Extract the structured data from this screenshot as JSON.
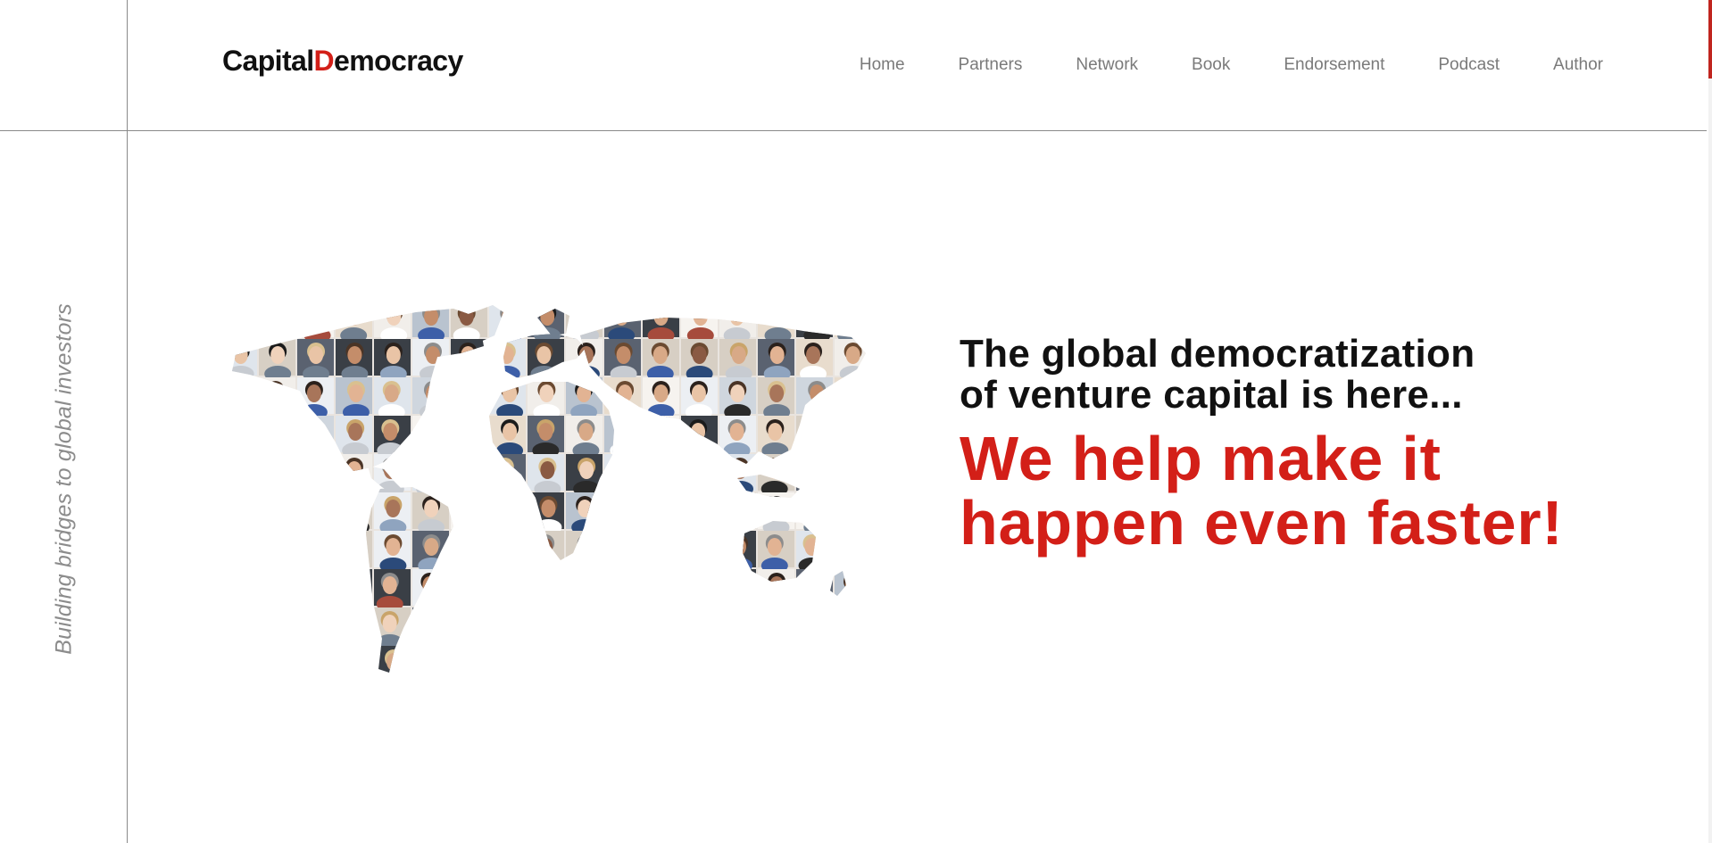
{
  "brand": {
    "logo_part1": "Capital",
    "logo_accent": "D",
    "logo_part2": "emocracy",
    "accent_color": "#d31f18"
  },
  "nav": {
    "items": [
      {
        "label": "Home"
      },
      {
        "label": "Partners"
      },
      {
        "label": "Network"
      },
      {
        "label": "Book"
      },
      {
        "label": "Endorsement"
      },
      {
        "label": "Podcast"
      },
      {
        "label": "Author"
      }
    ]
  },
  "side": {
    "tagline": "Building bridges to global investors"
  },
  "hero": {
    "map_icon": "world-map-photo-collage",
    "subheading_line1": "The global democratization",
    "subheading_line2": "of venture capital is here...",
    "headline_line1": "We help make it",
    "headline_line2": "happen even faster!"
  }
}
